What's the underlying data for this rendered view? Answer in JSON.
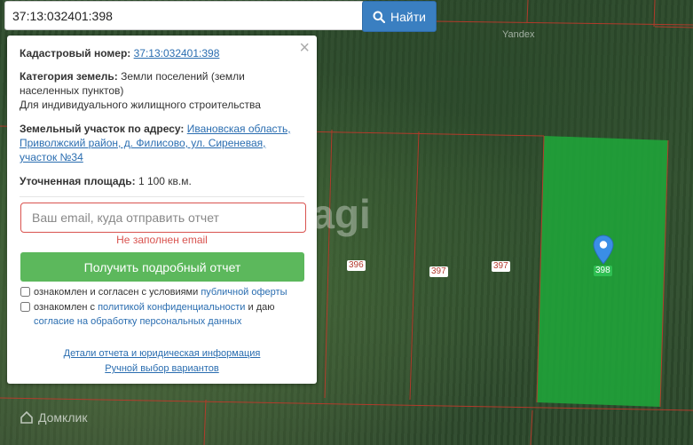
{
  "search": {
    "value": "37:13:032401:398",
    "button_label": "Найти"
  },
  "map": {
    "provider_text": "Yandex",
    "watermark": "tagi",
    "plot_labels": [
      "396",
      "397",
      "397",
      "398"
    ],
    "brand": "Домклик",
    "selected_color": "#1fa83a"
  },
  "panel": {
    "cadastral_label": "Кадастровый номер:",
    "cadastral_value": "37:13:032401:398",
    "category_label": "Категория земель:",
    "category_value": "Земли поселений (земли населенных пунктов)",
    "usage": "Для индивидуального жилищного строительства",
    "address_label": "Земельный участок по адресу:",
    "address_value": "Ивановская область, Приволжский район, д. Филисово, ул. Сиреневая, участок №34",
    "area_label": "Уточненная площадь:",
    "area_value": "1 100 кв.м.",
    "email_placeholder": "Ваш email, куда отправить отчет",
    "email_error": "Не заполнен email",
    "report_button": "Получить подробный отчет",
    "consent1_text": "ознакомлен и согласен с условиями ",
    "consent1_link": "публичной оферты",
    "consent2_text": "ознакомлен с ",
    "consent2_link1": "политикой конфиденциальности",
    "consent2_mid": " и даю",
    "consent2_link2": "согласие на обработку персональных данных",
    "details_link": "Детали отчета и юридическая информация",
    "manual_link": "Ручной выбор вариантов"
  }
}
